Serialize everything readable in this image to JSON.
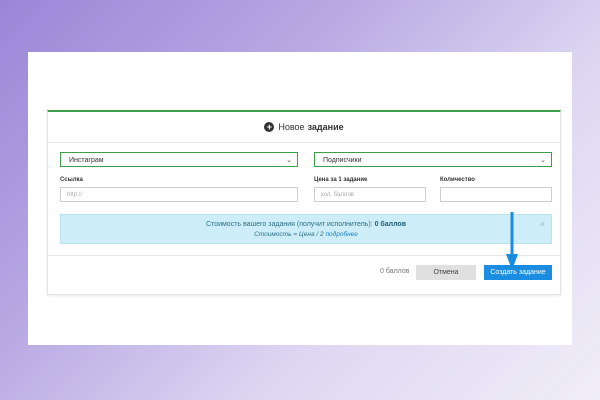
{
  "modal": {
    "title_prefix": "Новое",
    "title_strong": "задание"
  },
  "form": {
    "platform_select": "Инстаграм",
    "type_select": "Подписчики",
    "link_label": "Ссылка",
    "link_placeholder": "http://",
    "price_label": "Цена за 1 задание",
    "price_placeholder": "кол. баллов",
    "quantity_label": "Количество",
    "quantity_value": ""
  },
  "info": {
    "line1_text": "Стоимость вашего задания (получит исполнитель):",
    "line1_value": "0 баллов",
    "line2_text": "Стоимость = Цена /",
    "line2_num": "2",
    "line2_link": "подробнее"
  },
  "footer": {
    "points": "0 баллов",
    "cancel_label": "Отмена",
    "create_label": "Создать задание"
  },
  "colors": {
    "accent_green": "#3aa14a",
    "primary_blue": "#1a8de0",
    "info_bg": "#cdeef8"
  }
}
